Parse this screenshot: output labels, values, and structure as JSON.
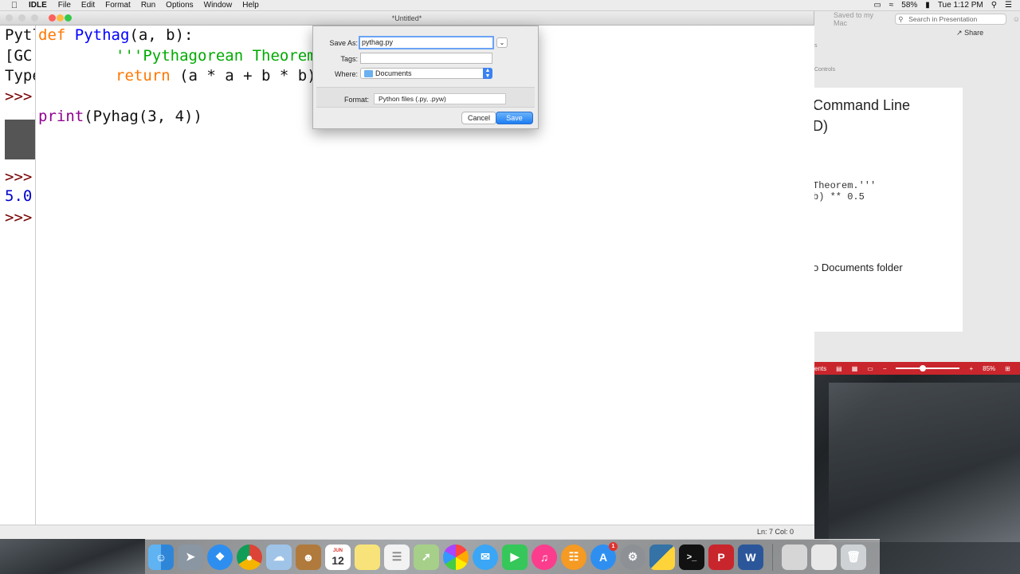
{
  "menubar": {
    "app_name": "IDLE",
    "items": [
      "File",
      "Edit",
      "Format",
      "Run",
      "Options",
      "Window",
      "Help"
    ],
    "battery": "58%",
    "clock": "Tue 1:12 PM"
  },
  "idle_window": {
    "title": "*Untitled*",
    "status": "Ln: 7   Col: 0"
  },
  "shell": {
    "lines": [
      "Pytl",
      "[GC(",
      "Type",
      ">>>",
      ">>>",
      "5.0",
      ">>>"
    ]
  },
  "editor": {
    "line1_kw": "def",
    "line1_fn": "Pythag",
    "line1_rest": "(a, b):",
    "line2": "'''Pythagorean Theorem",
    "line3_kw": "return",
    "line3_rest": " (a * a + b * b)",
    "line5_bi": "print",
    "line5_rest": "(Pyhag(3, 4))"
  },
  "save_dialog": {
    "save_as_label": "Save As:",
    "save_as_value": "pythag.py",
    "tags_label": "Tags:",
    "tags_value": "",
    "where_label": "Where:",
    "where_value": "Documents",
    "format_label": "Format:",
    "format_value": "Python files (.py, .pyw)",
    "cancel_label": "Cancel",
    "save_label": "Save"
  },
  "powerpoint": {
    "saved_text": "Saved to my Mac",
    "search_placeholder": "Search in Presentation",
    "share_label": "Share",
    "side_label": "Controls",
    "slide_title_1": "Command Line",
    "slide_title_2": "D)",
    "code_line_1": "Theorem.'''",
    "code_line_2": "b) ** 0.5",
    "bullet": "o Documents folder",
    "status_left": "ents",
    "zoom": "85%"
  },
  "dock": {
    "icons": [
      "finder-icon",
      "launchpad-icon",
      "safari-icon",
      "chrome-icon",
      "preview-icon",
      "contacts-icon",
      "calendar-icon",
      "notes-icon",
      "reminders-icon",
      "maps-icon",
      "photos-icon",
      "messages-icon",
      "facetime-icon",
      "itunes-icon",
      "ibooks-icon",
      "app-store-icon",
      "system-preferences-icon",
      "python-icon",
      "terminal-icon",
      "powerpoint-icon",
      "word-icon",
      "downloads-icon",
      "documents-icon",
      "trash-icon"
    ],
    "calendar_month": "JUN",
    "calendar_day": "12",
    "app_store_badge": "1"
  },
  "colors": {
    "keyword": "#ff7700",
    "function": "#0000ff",
    "string": "#00aa00",
    "builtin": "#900090",
    "accent": "#1e7ef2",
    "ppt_red": "#c8262c"
  }
}
